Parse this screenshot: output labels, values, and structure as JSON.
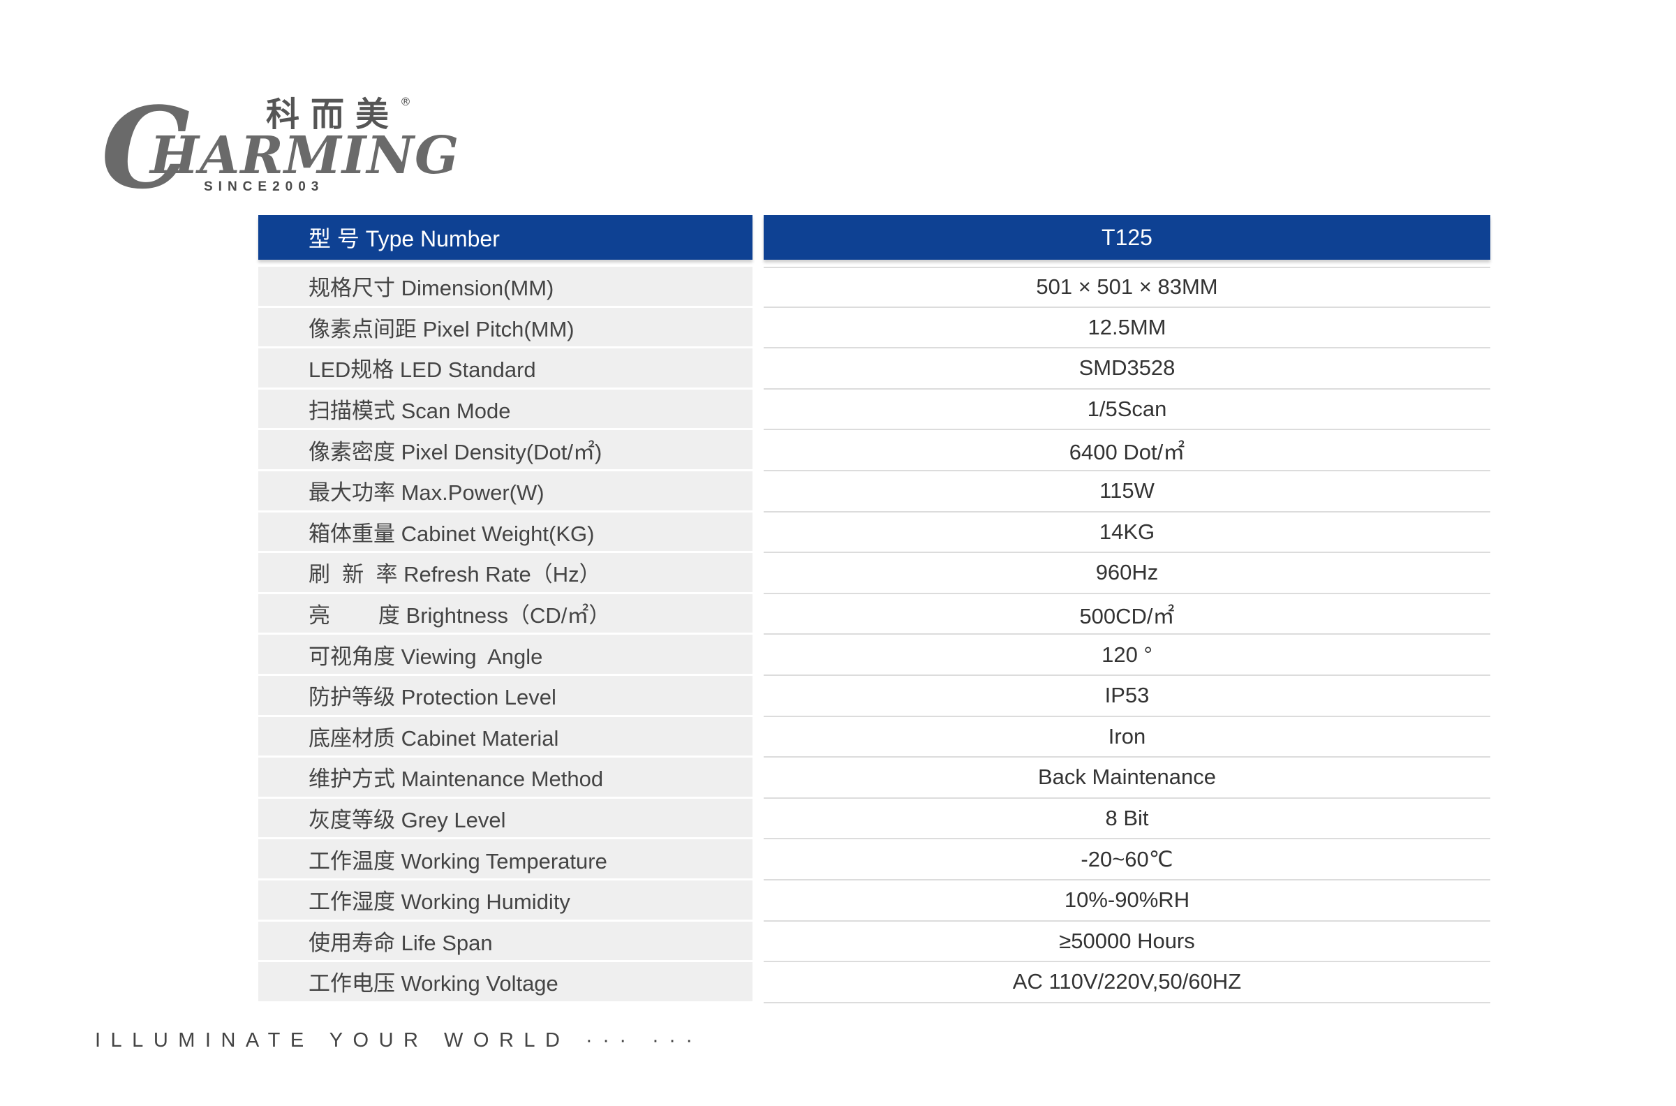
{
  "brand": {
    "logo_text": "CHARMING",
    "chinese_name": "科而美",
    "registered_mark": "®",
    "since": "SINCE2003"
  },
  "table": {
    "header": {
      "label": "型    号 Type Number",
      "value": "T125"
    },
    "rows": [
      {
        "label": "规格尺寸 Dimension(MM)",
        "value": "501 × 501 × 83MM"
      },
      {
        "label": "像素点间距 Pixel Pitch(MM)",
        "value": "12.5MM"
      },
      {
        "label": "LED规格 LED Standard",
        "value": "SMD3528"
      },
      {
        "label": "扫描模式 Scan Mode",
        "value": "1/5Scan"
      },
      {
        "label": "像素密度 Pixel Density(Dot/㎡)",
        "value": "6400 Dot/㎡"
      },
      {
        "label": "最大功率 Max.Power(W)",
        "value": "115W"
      },
      {
        "label": "箱体重量 Cabinet Weight(KG)",
        "value": "14KG"
      },
      {
        "label": "刷  新  率 Refresh Rate（Hz）",
        "value": "960Hz"
      },
      {
        "label": "亮        度 Brightness（CD/㎡）",
        "value": "500CD/㎡"
      },
      {
        "label": "可视角度 Viewing  Angle",
        "value": "120 °"
      },
      {
        "label": "防护等级 Protection Level",
        "value": "IP53"
      },
      {
        "label": "底座材质 Cabinet Material",
        "value": "Iron"
      },
      {
        "label": "维护方式 Maintenance Method",
        "value": "Back Maintenance"
      },
      {
        "label": "灰度等级 Grey Level",
        "value": "8 Bit"
      },
      {
        "label": "工作温度 Working Temperature",
        "value": "-20~60℃"
      },
      {
        "label": "工作湿度 Working Humidity",
        "value": "10%-90%RH"
      },
      {
        "label": "使用寿命 Life Span",
        "value": "≥50000 Hours"
      },
      {
        "label": "工作电压 Working Voltage",
        "value": "AC 110V/220V,50/60HZ"
      }
    ]
  },
  "tagline": "ILLUMINATE YOUR WORLD ··· ···"
}
